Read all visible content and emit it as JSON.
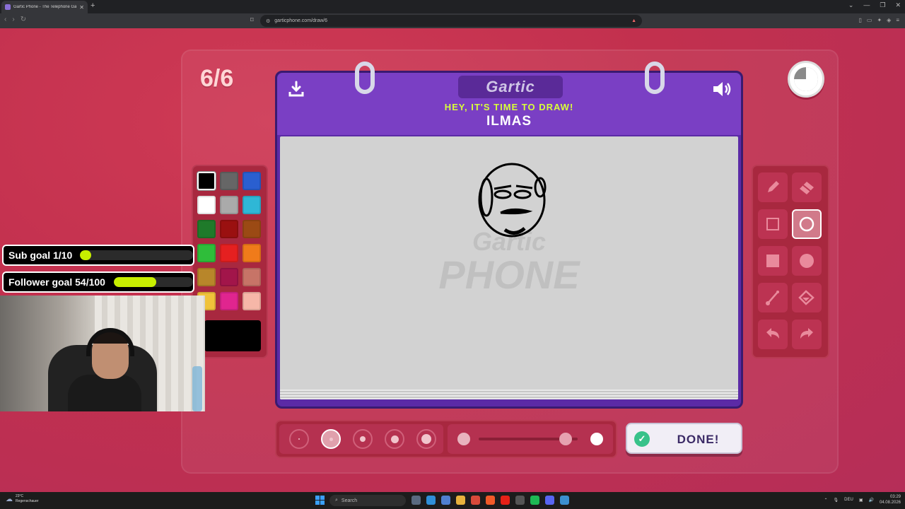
{
  "browser": {
    "tab_title": "Gartic Phone - The Telephone Game",
    "tab_close": "✕",
    "new_tab": "+",
    "url": "garticphone.com/draw/6",
    "window_controls": [
      "⌄",
      "—",
      "❐",
      "✕"
    ]
  },
  "game": {
    "round_counter": "6/6",
    "logo_text": "Gartic",
    "prompt_label": "HEY, IT'S TIME TO DRAW!",
    "word": "ILMAS",
    "watermark_top": "Gartic",
    "watermark_bottom": "PHONE",
    "done_label": "DONE!",
    "done_check": "✓",
    "timer_remaining_fraction": 0.25
  },
  "palette": {
    "colors": [
      "#000000",
      "#666666",
      "#2a5fd0",
      "#ffffff",
      "#aaaaaa",
      "#2fb7d6",
      "#1f7a2a",
      "#9a1010",
      "#9b4a14",
      "#2fbd3a",
      "#e52020",
      "#f07b1a",
      "#b8862a",
      "#a2154a",
      "#c77467",
      "#f0c23a",
      "#e0258f",
      "#f6b7a8"
    ],
    "selected_color": "#000000"
  },
  "tools": {
    "items": [
      "pencil-tool",
      "eraser-tool",
      "rectangle-outline-tool",
      "ellipse-outline-tool",
      "rectangle-fill-tool",
      "ellipse-fill-tool",
      "line-tool",
      "fill-bucket-tool",
      "undo-tool",
      "redo-tool"
    ],
    "selected": "ellipse-outline-tool"
  },
  "brush": {
    "sizes": 5,
    "selected_size_index": 1,
    "opacity_fraction": 0.88
  },
  "overlay": {
    "sub_goal_label": "Sub goal 1/10",
    "sub_goal_fraction": 0.1,
    "follower_goal_label": "Follower goal 54/100",
    "follower_goal_fraction": 0.54
  },
  "taskbar": {
    "weather_temp": "23°C",
    "weather_desc": "Regenschauer",
    "search_label": "Search",
    "language": "DEU",
    "time": "03:29",
    "date": "04.08.2026"
  }
}
